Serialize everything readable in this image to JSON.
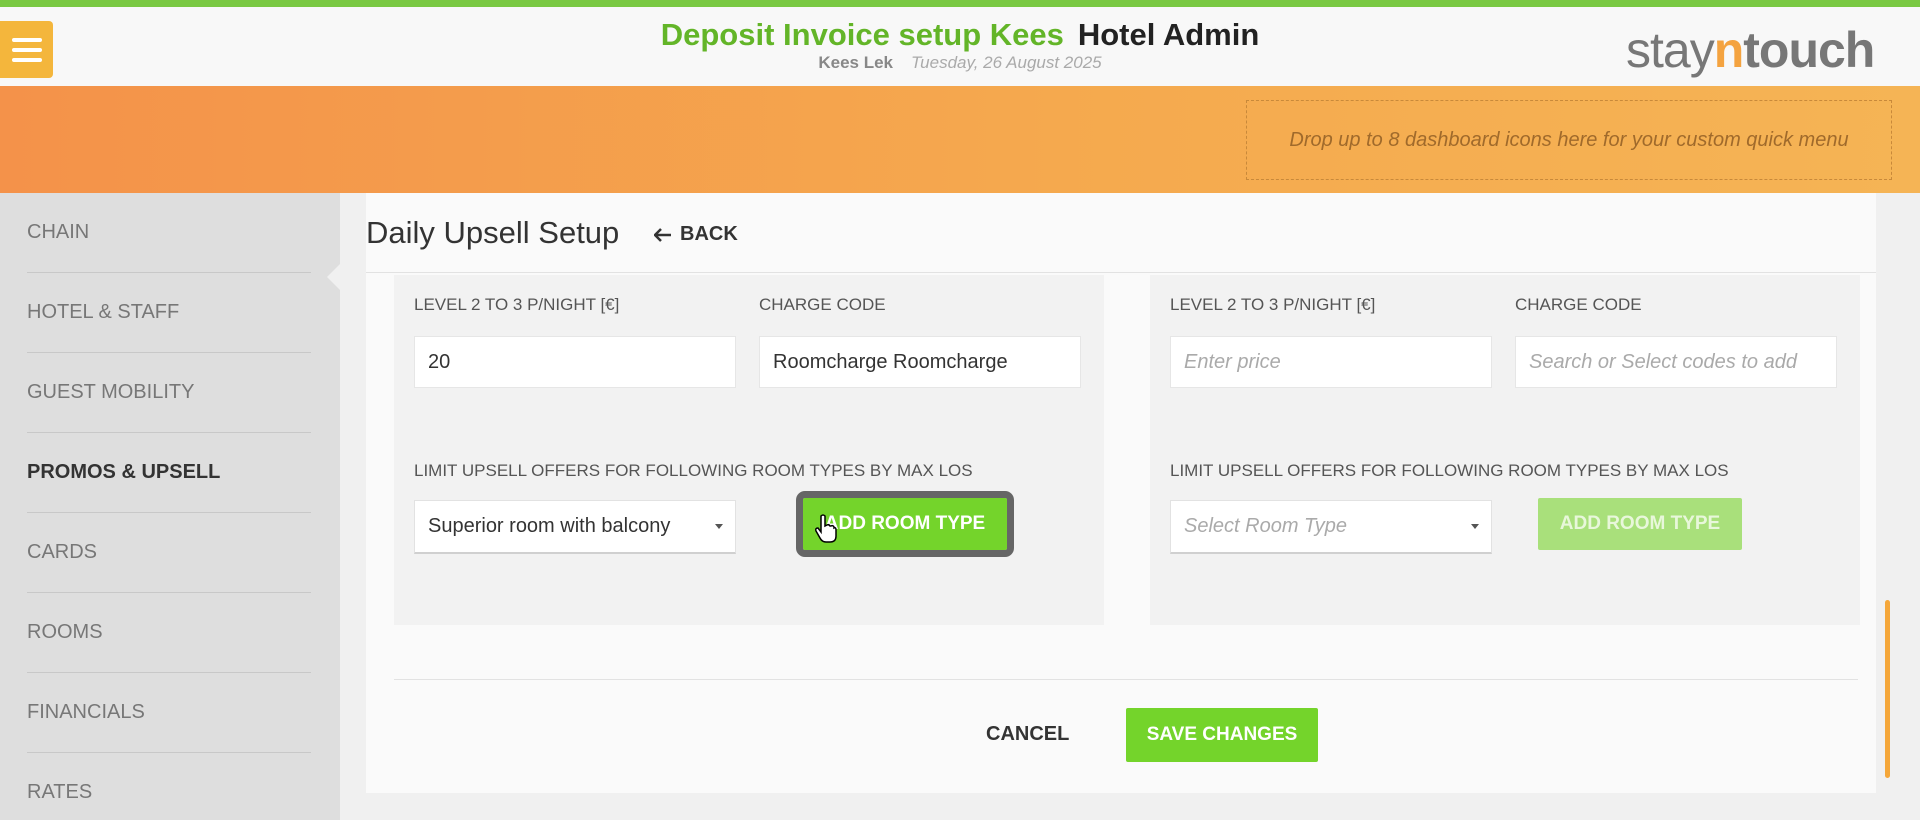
{
  "header": {
    "title": "Deposit Invoice setup Kees",
    "app_name": "Hotel Admin",
    "user": "Kees Lek",
    "date": "Tuesday, 26 August 2025",
    "logo_stay": "stay",
    "logo_n": "n",
    "logo_touch": "touch",
    "dropzone_text": "Drop up to 8 dashboard icons here for your custom quick menu"
  },
  "sidebar": {
    "items": [
      {
        "label": "CHAIN"
      },
      {
        "label": "HOTEL & STAFF"
      },
      {
        "label": "GUEST MOBILITY"
      },
      {
        "label": "PROMOS & UPSELL",
        "active": true
      },
      {
        "label": "CARDS"
      },
      {
        "label": "ROOMS"
      },
      {
        "label": "FINANCIALS"
      },
      {
        "label": "RATES"
      }
    ]
  },
  "page": {
    "title": "Daily Upsell Setup",
    "back_label": "BACK"
  },
  "left_panel": {
    "price_label": "LEVEL 2 TO 3 P/NIGHT [€]",
    "price_value": "20",
    "charge_label": "CHARGE CODE",
    "charge_value": "Roomcharge Roomcharge",
    "limit_label": "LIMIT UPSELL OFFERS FOR FOLLOWING ROOM TYPES BY MAX LOS",
    "room_type_value": "Superior room with balcony",
    "add_label": "ADD ROOM TYPE"
  },
  "right_panel": {
    "price_label": "LEVEL 2 TO 3 P/NIGHT [€]",
    "price_placeholder": "Enter price",
    "charge_label": "CHARGE CODE",
    "charge_placeholder": "Search or Select codes to add",
    "limit_label": "LIMIT UPSELL OFFERS FOR FOLLOWING ROOM TYPES BY MAX LOS",
    "room_type_placeholder": "Select Room Type",
    "add_label": "ADD ROOM TYPE"
  },
  "footer": {
    "cancel_label": "CANCEL",
    "save_label": "SAVE CHANGES"
  },
  "colors": {
    "accent_green": "#74d42b",
    "title_green": "#63b528",
    "banner_orange": "#f4924a",
    "menu_yellow": "#f4b63c"
  },
  "icons": {
    "menu": "hamburger-icon",
    "back": "arrow-left-icon",
    "caret": "caret-down-icon",
    "cursor": "hand-pointer-icon"
  }
}
